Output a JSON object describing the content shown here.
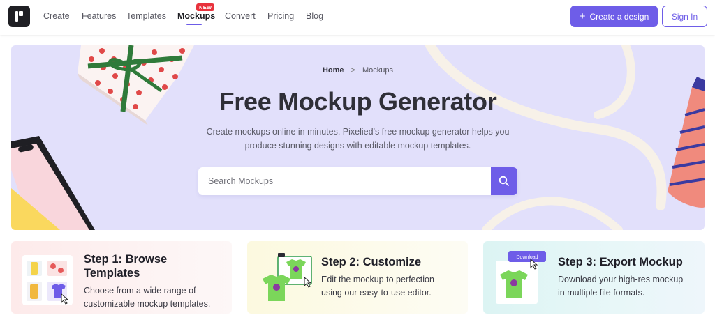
{
  "nav": {
    "logo_name": "pixelied-logo",
    "links": [
      {
        "label": "Create"
      },
      {
        "label": "Features"
      },
      {
        "label": "Templates"
      },
      {
        "label": "Mockups",
        "active": true,
        "badge": "NEW"
      },
      {
        "label": "Convert"
      },
      {
        "label": "Pricing"
      },
      {
        "label": "Blog"
      }
    ],
    "create_button": "Create a design",
    "signin_button": "Sign In"
  },
  "hero": {
    "breadcrumb": {
      "home": "Home",
      "separator": ">",
      "current": "Mockups"
    },
    "title": "Free Mockup Generator",
    "subtitle_line1": "Create mockups online in minutes. Pixelied's free mockup generator helps you",
    "subtitle_line2": "produce stunning designs with editable mockup templates.",
    "search_placeholder": "Search Mockups"
  },
  "steps": [
    {
      "title_line1": "Step 1: Browse",
      "title_line2": "Templates",
      "desc_line1": "Choose from a wide range of",
      "desc_line2": "customizable mockup templates."
    },
    {
      "title": "Step 2: Customize",
      "desc_line1": "Edit the mockup to perfection",
      "desc_line2": "using our easy-to-use editor."
    },
    {
      "title": "Step 3: Export Mockup",
      "desc_line1": "Download your high-res mockup",
      "desc_line2": "in multiple file formats.",
      "download_label": "Download"
    }
  ],
  "colors": {
    "brand": "#6e5de8",
    "hero_bg": "#e2e0fb",
    "badge": "#e8323c"
  }
}
